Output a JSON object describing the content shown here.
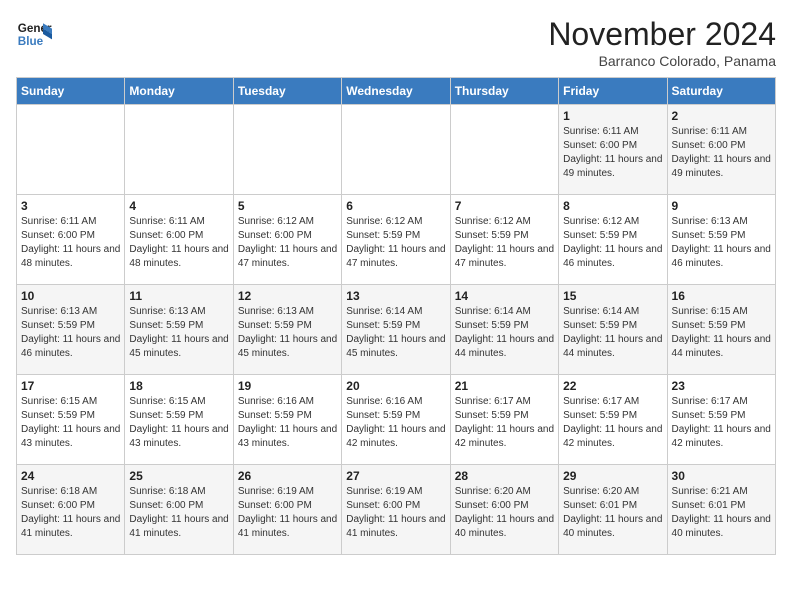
{
  "logo": {
    "line1": "General",
    "line2": "Blue"
  },
  "header": {
    "month_year": "November 2024",
    "location": "Barranco Colorado, Panama"
  },
  "days_of_week": [
    "Sunday",
    "Monday",
    "Tuesday",
    "Wednesday",
    "Thursday",
    "Friday",
    "Saturday"
  ],
  "weeks": [
    [
      {
        "num": "",
        "info": ""
      },
      {
        "num": "",
        "info": ""
      },
      {
        "num": "",
        "info": ""
      },
      {
        "num": "",
        "info": ""
      },
      {
        "num": "",
        "info": ""
      },
      {
        "num": "1",
        "info": "Sunrise: 6:11 AM\nSunset: 6:00 PM\nDaylight: 11 hours and 49 minutes."
      },
      {
        "num": "2",
        "info": "Sunrise: 6:11 AM\nSunset: 6:00 PM\nDaylight: 11 hours and 49 minutes."
      }
    ],
    [
      {
        "num": "3",
        "info": "Sunrise: 6:11 AM\nSunset: 6:00 PM\nDaylight: 11 hours and 48 minutes."
      },
      {
        "num": "4",
        "info": "Sunrise: 6:11 AM\nSunset: 6:00 PM\nDaylight: 11 hours and 48 minutes."
      },
      {
        "num": "5",
        "info": "Sunrise: 6:12 AM\nSunset: 6:00 PM\nDaylight: 11 hours and 47 minutes."
      },
      {
        "num": "6",
        "info": "Sunrise: 6:12 AM\nSunset: 5:59 PM\nDaylight: 11 hours and 47 minutes."
      },
      {
        "num": "7",
        "info": "Sunrise: 6:12 AM\nSunset: 5:59 PM\nDaylight: 11 hours and 47 minutes."
      },
      {
        "num": "8",
        "info": "Sunrise: 6:12 AM\nSunset: 5:59 PM\nDaylight: 11 hours and 46 minutes."
      },
      {
        "num": "9",
        "info": "Sunrise: 6:13 AM\nSunset: 5:59 PM\nDaylight: 11 hours and 46 minutes."
      }
    ],
    [
      {
        "num": "10",
        "info": "Sunrise: 6:13 AM\nSunset: 5:59 PM\nDaylight: 11 hours and 46 minutes."
      },
      {
        "num": "11",
        "info": "Sunrise: 6:13 AM\nSunset: 5:59 PM\nDaylight: 11 hours and 45 minutes."
      },
      {
        "num": "12",
        "info": "Sunrise: 6:13 AM\nSunset: 5:59 PM\nDaylight: 11 hours and 45 minutes."
      },
      {
        "num": "13",
        "info": "Sunrise: 6:14 AM\nSunset: 5:59 PM\nDaylight: 11 hours and 45 minutes."
      },
      {
        "num": "14",
        "info": "Sunrise: 6:14 AM\nSunset: 5:59 PM\nDaylight: 11 hours and 44 minutes."
      },
      {
        "num": "15",
        "info": "Sunrise: 6:14 AM\nSunset: 5:59 PM\nDaylight: 11 hours and 44 minutes."
      },
      {
        "num": "16",
        "info": "Sunrise: 6:15 AM\nSunset: 5:59 PM\nDaylight: 11 hours and 44 minutes."
      }
    ],
    [
      {
        "num": "17",
        "info": "Sunrise: 6:15 AM\nSunset: 5:59 PM\nDaylight: 11 hours and 43 minutes."
      },
      {
        "num": "18",
        "info": "Sunrise: 6:15 AM\nSunset: 5:59 PM\nDaylight: 11 hours and 43 minutes."
      },
      {
        "num": "19",
        "info": "Sunrise: 6:16 AM\nSunset: 5:59 PM\nDaylight: 11 hours and 43 minutes."
      },
      {
        "num": "20",
        "info": "Sunrise: 6:16 AM\nSunset: 5:59 PM\nDaylight: 11 hours and 42 minutes."
      },
      {
        "num": "21",
        "info": "Sunrise: 6:17 AM\nSunset: 5:59 PM\nDaylight: 11 hours and 42 minutes."
      },
      {
        "num": "22",
        "info": "Sunrise: 6:17 AM\nSunset: 5:59 PM\nDaylight: 11 hours and 42 minutes."
      },
      {
        "num": "23",
        "info": "Sunrise: 6:17 AM\nSunset: 5:59 PM\nDaylight: 11 hours and 42 minutes."
      }
    ],
    [
      {
        "num": "24",
        "info": "Sunrise: 6:18 AM\nSunset: 6:00 PM\nDaylight: 11 hours and 41 minutes."
      },
      {
        "num": "25",
        "info": "Sunrise: 6:18 AM\nSunset: 6:00 PM\nDaylight: 11 hours and 41 minutes."
      },
      {
        "num": "26",
        "info": "Sunrise: 6:19 AM\nSunset: 6:00 PM\nDaylight: 11 hours and 41 minutes."
      },
      {
        "num": "27",
        "info": "Sunrise: 6:19 AM\nSunset: 6:00 PM\nDaylight: 11 hours and 41 minutes."
      },
      {
        "num": "28",
        "info": "Sunrise: 6:20 AM\nSunset: 6:00 PM\nDaylight: 11 hours and 40 minutes."
      },
      {
        "num": "29",
        "info": "Sunrise: 6:20 AM\nSunset: 6:01 PM\nDaylight: 11 hours and 40 minutes."
      },
      {
        "num": "30",
        "info": "Sunrise: 6:21 AM\nSunset: 6:01 PM\nDaylight: 11 hours and 40 minutes."
      }
    ]
  ]
}
